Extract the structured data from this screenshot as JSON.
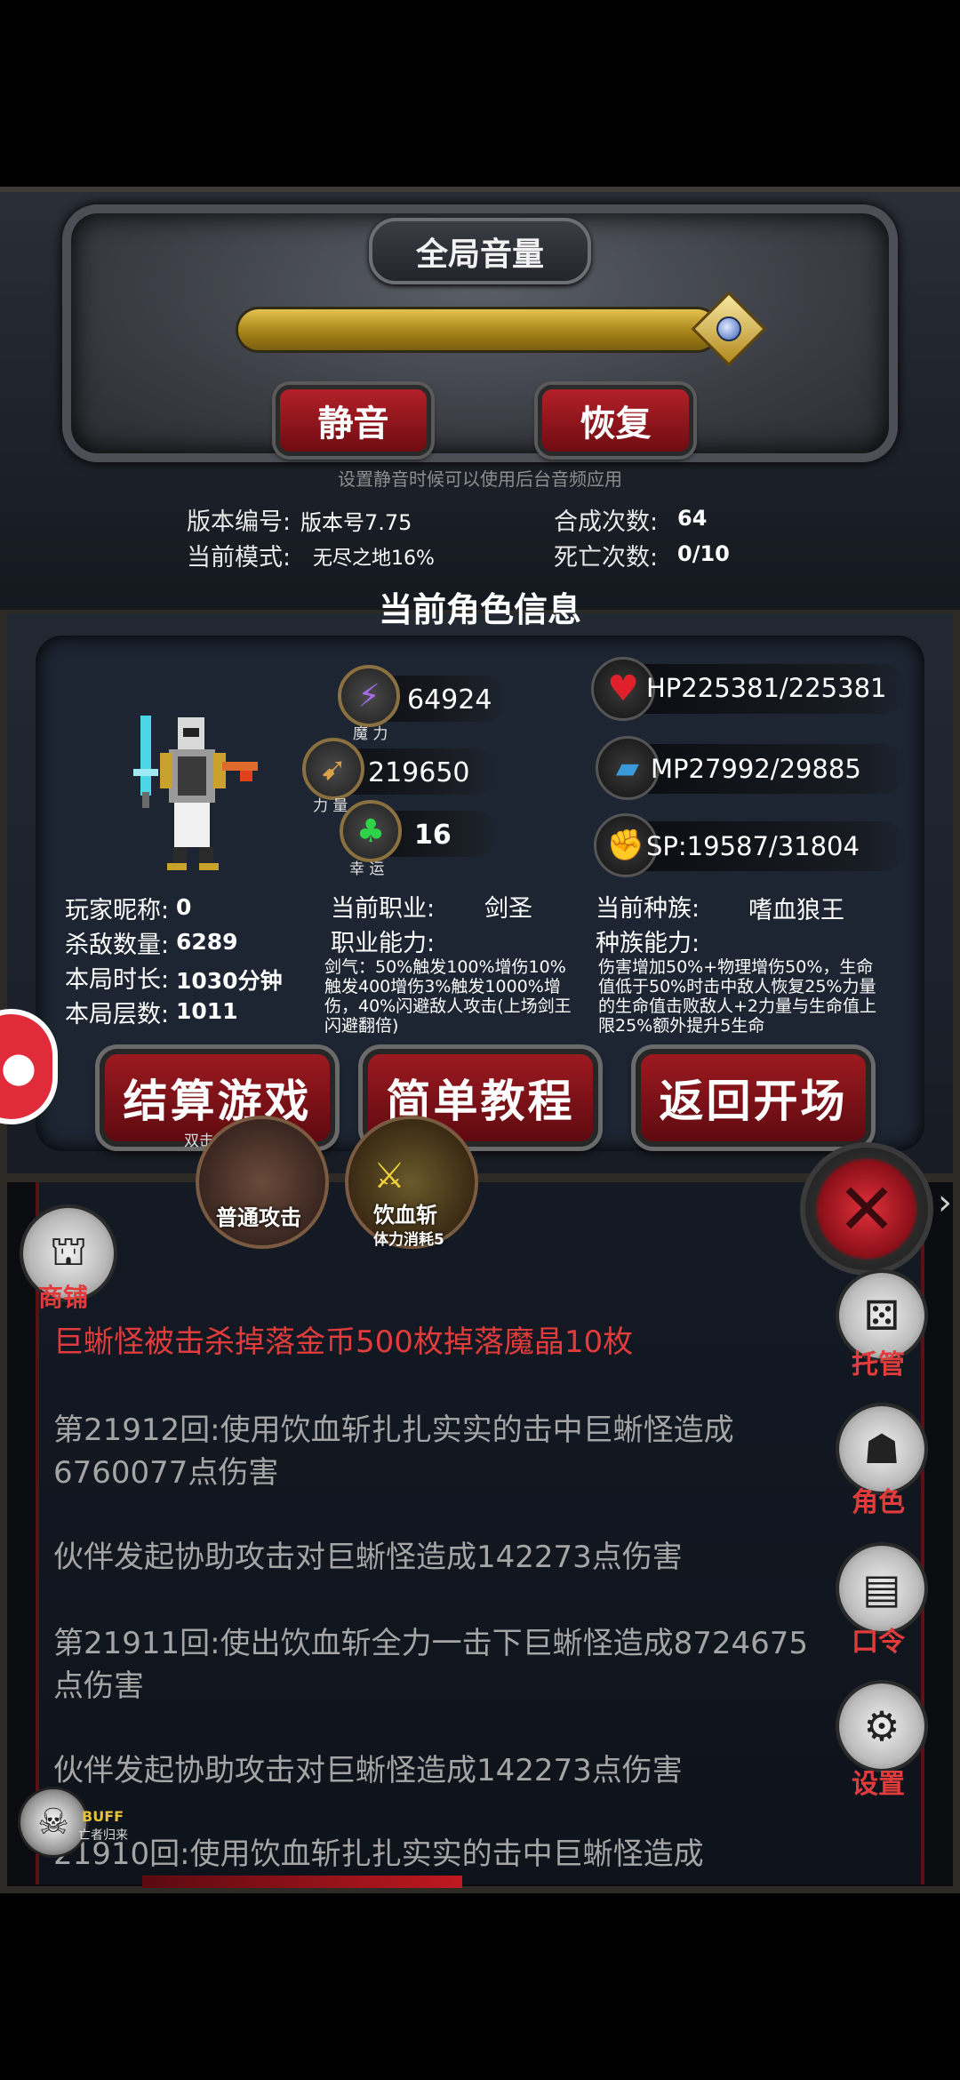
{
  "settings": {
    "title": "全局音量",
    "volume_level": 1.0,
    "mute_label": "静音",
    "restore_label": "恢复",
    "hint": "设置静音时候可以使用后台音频应用",
    "version_label": "版本编号:",
    "version_value": "版本号7.75",
    "mode_label": "当前模式:",
    "mode_value": "无尽之地16%",
    "synth_label": "合成次数:",
    "synth_value": "64",
    "death_label": "死亡次数:",
    "death_value": "0/10"
  },
  "character": {
    "header": "当前角色信息",
    "stats": {
      "magic": {
        "value": "64924",
        "caption": "魔 力",
        "icon": "lightning-icon"
      },
      "strength": {
        "value": "219650",
        "caption": "力 量",
        "icon": "bow-icon"
      },
      "luck": {
        "value": "16",
        "caption": "幸 运",
        "icon": "clover-icon"
      }
    },
    "vitals": {
      "hp": {
        "text": "HP225381/225381",
        "icon": "heart-icon"
      },
      "mp": {
        "text": "MP27992/29885",
        "icon": "shoe-icon"
      },
      "sp": {
        "text": "SP:19587/31804",
        "icon": "muscle-icon"
      }
    },
    "nickname_label": "玩家昵称:",
    "nickname_value": "0",
    "kills_label": "杀敌数量:",
    "kills_value": "6289",
    "duration_label": "本局时长:",
    "duration_value": "1030分钟",
    "floor_label": "本局层数:",
    "floor_value": "1011",
    "class_label": "当前职业:",
    "class_value": "剑圣",
    "class_ability_label": "职业能力:",
    "class_ability_text": "剑气：50%触发100%增伤10%触发400增伤3%触发1000%增伤，40%闪避敌人攻击(上场剑王闪避翻倍)",
    "race_label": "当前种族:",
    "race_value": "嗜血狼王",
    "race_ability_label": "种族能力:",
    "race_ability_text": "伤害增加50%+物理增伤50%，生命值低于50%时击中敌人恢复25%力量的生命值击败敌人+2力量与生命值上限25%额外提升5生命"
  },
  "actions": {
    "settle": "结算游戏",
    "settle_sub": "双击生效",
    "tutorial": "简单教程",
    "return": "返回开场"
  },
  "skills": {
    "normal_attack": "普通攻击",
    "blood_slash": "饮血斩",
    "blood_slash_cost": "体力消耗5"
  },
  "side_menu": {
    "shop": "商铺",
    "auto": "托管",
    "role": "角色",
    "code": "口令",
    "settings": "设置"
  },
  "buff": {
    "label": "BUFF",
    "sub": "亡者归来"
  },
  "log": [
    "巨蜥怪被击杀掉落金币500枚掉落魔晶10枚",
    "第21912回:使用饮血斩扎扎实实的击中巨蜥怪造成6760077点伤害",
    "伙伴发起协助攻击对巨蜥怪造成142273点伤害",
    "第21911回:使出饮血斩全力一击下巨蜥怪造成8724675点伤害",
    "伙伴发起协助攻击对巨蜥怪造成142273点伤害",
    "21910回:使用饮血斩扎扎实实的击中巨蜥怪造成"
  ],
  "colors": {
    "accent_red": "#e03c3c",
    "gold": "#c9a22e",
    "log_text": "#a5a5a5"
  }
}
